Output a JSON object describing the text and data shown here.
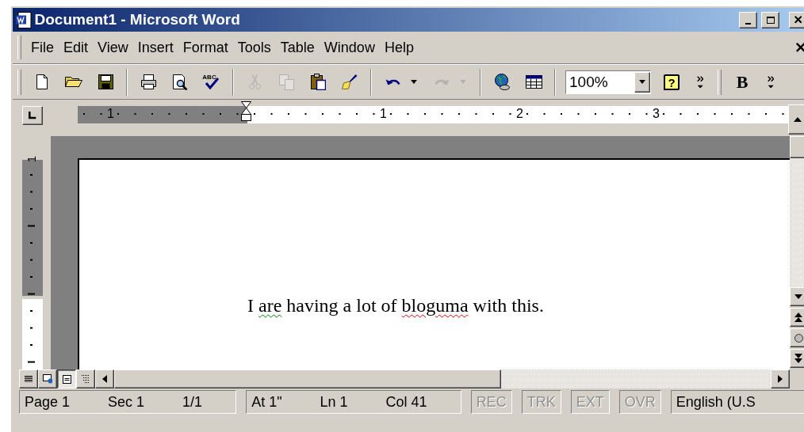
{
  "window": {
    "title": "Document1 - Microsoft Word"
  },
  "menu_bar": {
    "items": [
      {
        "label": "File"
      },
      {
        "label": "Edit"
      },
      {
        "label": "View"
      },
      {
        "label": "Insert"
      },
      {
        "label": "Format"
      },
      {
        "label": "Tools"
      },
      {
        "label": "Table"
      },
      {
        "label": "Window"
      },
      {
        "label": "Help"
      }
    ]
  },
  "toolbar": {
    "items": [
      {
        "kind": "button",
        "disabled": false
      },
      {
        "kind": "button",
        "disabled": false
      },
      {
        "kind": "button",
        "disabled": false
      },
      {
        "kind": "separator"
      },
      {
        "kind": "button",
        "disabled": false
      },
      {
        "kind": "button",
        "disabled": false
      },
      {
        "kind": "button",
        "disabled": false,
        "glyph": "ABC"
      },
      {
        "kind": "separator"
      },
      {
        "kind": "button",
        "disabled": true
      },
      {
        "kind": "button",
        "disabled": true
      },
      {
        "kind": "button",
        "disabled": false
      },
      {
        "kind": "button",
        "disabled": false
      },
      {
        "kind": "separator"
      },
      {
        "kind": "button",
        "disabled": false
      },
      {
        "kind": "dropdown",
        "disabled": false
      },
      {
        "kind": "button",
        "disabled": true
      },
      {
        "kind": "dropdown",
        "disabled": true
      },
      {
        "kind": "separator"
      },
      {
        "kind": "button",
        "disabled": false
      },
      {
        "kind": "button",
        "disabled": false
      },
      {
        "kind": "separator"
      },
      {
        "kind": "combo",
        "value": "100%"
      },
      {
        "kind": "help",
        "label": "?"
      },
      {
        "kind": "overflow"
      },
      {
        "kind": "gripper"
      },
      {
        "kind": "text-button",
        "label": "B"
      },
      {
        "kind": "overflow"
      }
    ]
  },
  "ruler": {
    "labels": [
      "1",
      "1",
      "2",
      "3"
    ]
  },
  "vertical_ruler": {
    "labels": [
      "1"
    ]
  },
  "document": {
    "runs": [
      {
        "text": "I ",
        "grammar_error": false,
        "spelling_error": false
      },
      {
        "text": "are",
        "grammar_error": true,
        "spelling_error": false
      },
      {
        "text": " having a lot of ",
        "grammar_error": false,
        "spelling_error": false
      },
      {
        "text": "bloguma",
        "grammar_error": false,
        "spelling_error": true
      },
      {
        "text": " with this.",
        "grammar_error": false,
        "spelling_error": false
      }
    ]
  },
  "view_buttons": [
    {
      "selected": false
    },
    {
      "selected": false
    },
    {
      "selected": true
    },
    {
      "selected": false
    }
  ],
  "status_bar": {
    "groups": [
      {
        "items": [
          {
            "text": "Page 1",
            "disabled": false
          },
          {
            "text": "Sec 1",
            "disabled": false
          },
          {
            "text": "1/1",
            "disabled": false
          }
        ]
      },
      {
        "items": [
          {
            "text": "At 1\"",
            "disabled": false
          },
          {
            "text": "Ln 1",
            "disabled": false
          },
          {
            "text": "Col 41",
            "disabled": false
          }
        ]
      },
      {
        "items": [
          {
            "text": "REC",
            "disabled": true
          }
        ]
      },
      {
        "items": [
          {
            "text": "TRK",
            "disabled": true
          }
        ]
      },
      {
        "items": [
          {
            "text": "EXT",
            "disabled": true
          }
        ]
      },
      {
        "items": [
          {
            "text": "OVR",
            "disabled": true
          }
        ]
      },
      {
        "items": [
          {
            "text": "English (U.S",
            "disabled": false
          }
        ]
      }
    ]
  }
}
